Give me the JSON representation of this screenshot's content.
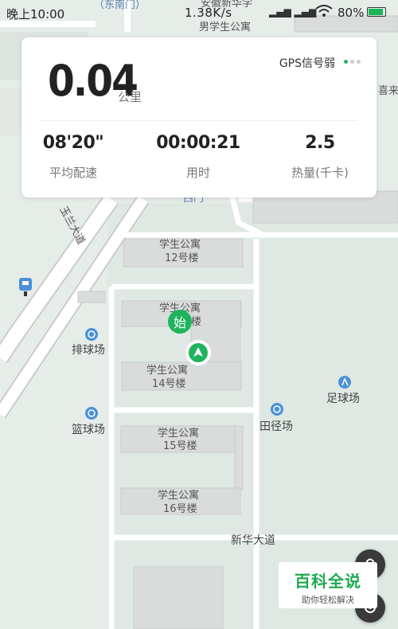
{
  "status_bar": {
    "time": "晚上10:00",
    "network_speed": "1.38K/s",
    "battery": "80%"
  },
  "run_card": {
    "distance": "0.04",
    "distance_unit": "公里",
    "gps_status": "GPS信号弱",
    "pace_value": "08'20\"",
    "pace_label": "平均配速",
    "time_value": "00:00:21",
    "time_label": "用时",
    "calories_value": "2.5",
    "calories_label": "热量(千卡)"
  },
  "map": {
    "labels": {
      "southeast_gate": "（东南门）",
      "anhui": "安徽新华学",
      "dorm_male": "男学生公寓",
      "west_gate": "西门",
      "xi_lai": "喜来",
      "road_diagonal": "玉兰大道",
      "dorm12_a": "学生公寓",
      "dorm12_b": "12号楼",
      "dorm13_a": "学生公寓",
      "dorm13_b": "楼",
      "dorm14_a": "学生公寓",
      "dorm14_b": "14号楼",
      "volleyball": "排球场",
      "basketball": "篮球场",
      "football": "足球场",
      "track": "田径场",
      "dorm15_a": "学生公寓",
      "dorm15_b": "15号楼",
      "dorm16_a": "学生公寓",
      "dorm16_b": "16号楼",
      "road_xinhua": "新华大道",
      "start_marker": "始"
    }
  },
  "watermark": {
    "title": "百科全说",
    "subtitle": "助你轻松解决"
  }
}
